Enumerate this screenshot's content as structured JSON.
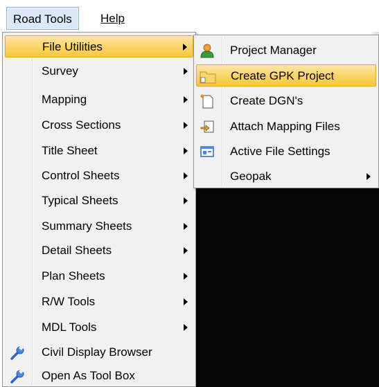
{
  "menubar": {
    "road_tools": "Road Tools",
    "help": "Help"
  },
  "main_menu": {
    "items": [
      {
        "label": "File Utilities",
        "has_submenu": true,
        "highlighted": true
      },
      {
        "label": "Survey",
        "has_submenu": true
      },
      {
        "label": "Mapping",
        "has_submenu": true
      },
      {
        "label": "Cross Sections",
        "has_submenu": true
      },
      {
        "label": "Title Sheet",
        "has_submenu": true
      },
      {
        "label": "Control Sheets",
        "has_submenu": true
      },
      {
        "label": "Typical Sheets",
        "has_submenu": true
      },
      {
        "label": "Summary Sheets",
        "has_submenu": true
      },
      {
        "label": "Detail Sheets",
        "has_submenu": true
      },
      {
        "label": "Plan Sheets",
        "has_submenu": true
      },
      {
        "label": "R/W Tools",
        "has_submenu": true
      },
      {
        "label": "MDL Tools",
        "has_submenu": true
      },
      {
        "label": "Civil Display Browser",
        "icon": "wrench-icon"
      },
      {
        "label": "Open As Tool Box",
        "icon": "wrench-icon"
      }
    ]
  },
  "submenu": {
    "items": [
      {
        "label": "Project Manager",
        "icon": "user-icon"
      },
      {
        "label": "Create GPK Project",
        "icon": "folder-icon",
        "highlighted": true
      },
      {
        "label": "Create DGN's",
        "icon": "new-file-icon"
      },
      {
        "label": "Attach Mapping Files",
        "icon": "attach-file-icon"
      },
      {
        "label": "Active File Settings",
        "icon": "settings-window-icon"
      },
      {
        "label": "Geopak",
        "has_submenu": true
      }
    ]
  },
  "colors": {
    "highlight": "#f7c73d",
    "menu_background": "#f1f1f1",
    "menubar_active": "#dbe8f7"
  }
}
